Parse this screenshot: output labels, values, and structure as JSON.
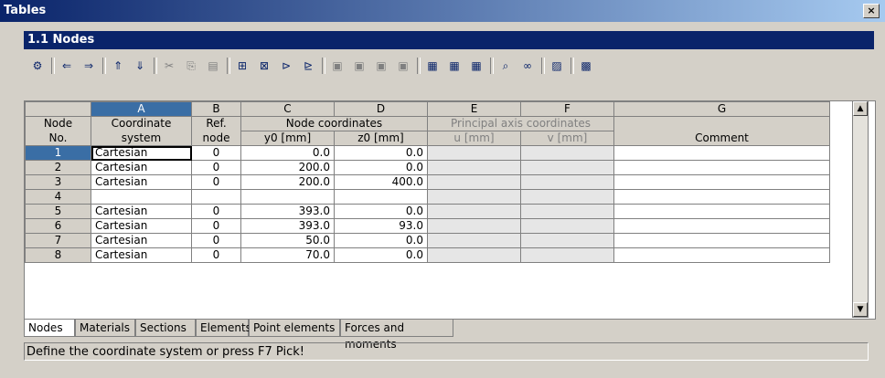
{
  "window": {
    "title": "Tables"
  },
  "panel": {
    "title": "1.1 Nodes"
  },
  "toolbar": {
    "buttons": [
      {
        "icon": "properties-icon",
        "glyph": "⚙"
      },
      {
        "icon": "arrow-left-icon",
        "glyph": "⇐"
      },
      {
        "icon": "arrow-right-icon",
        "glyph": "⇒"
      },
      {
        "icon": "move-up-icon",
        "glyph": "⇑"
      },
      {
        "icon": "move-down-icon",
        "glyph": "⇓"
      },
      {
        "icon": "cut-icon",
        "glyph": "✂"
      },
      {
        "icon": "copy-icon",
        "glyph": "⎘"
      },
      {
        "icon": "paste-icon",
        "glyph": "▤"
      },
      {
        "icon": "insert-row-icon",
        "glyph": "⊞"
      },
      {
        "icon": "delete-row-icon",
        "glyph": "⊠"
      },
      {
        "icon": "insert-column-icon",
        "glyph": "⊳"
      },
      {
        "icon": "append-column-icon",
        "glyph": "⊵"
      },
      {
        "icon": "view1-icon",
        "glyph": "▣"
      },
      {
        "icon": "view2-icon",
        "glyph": "▣"
      },
      {
        "icon": "view3-icon",
        "glyph": "▣"
      },
      {
        "icon": "view4-icon",
        "glyph": "▣"
      },
      {
        "icon": "screen1-icon",
        "glyph": "▦"
      },
      {
        "icon": "screen2-icon",
        "glyph": "▦"
      },
      {
        "icon": "screen3-icon",
        "glyph": "▦"
      },
      {
        "icon": "filter-icon",
        "glyph": "⌕"
      },
      {
        "icon": "glasses-icon",
        "glyph": "∞"
      },
      {
        "icon": "picture-icon",
        "glyph": "▨"
      },
      {
        "icon": "calculator-icon",
        "glyph": "▩"
      }
    ]
  },
  "table": {
    "col_letters": [
      "A",
      "B",
      "C",
      "D",
      "E",
      "F",
      "G"
    ],
    "headers": {
      "node_no_1": "Node",
      "node_no_2": "No.",
      "a_1": "Coordinate",
      "a_2": "system",
      "b_1": "Ref.",
      "b_2": "node",
      "cd_1": "Node coordinates",
      "c_2": "y0 [mm]",
      "d_2": "z0 [mm]",
      "ef_1": "Principal axis coordinates",
      "e_2": "u [mm]",
      "f_2": "v [mm]",
      "g_2": "Comment"
    },
    "rows": [
      {
        "no": "1",
        "system": "Cartesian",
        "ref": "0",
        "y": "0.0",
        "z": "0.0",
        "u": "",
        "v": "",
        "comment": ""
      },
      {
        "no": "2",
        "system": "Cartesian",
        "ref": "0",
        "y": "200.0",
        "z": "0.0",
        "u": "",
        "v": "",
        "comment": ""
      },
      {
        "no": "3",
        "system": "Cartesian",
        "ref": "0",
        "y": "200.0",
        "z": "400.0",
        "u": "",
        "v": "",
        "comment": ""
      },
      {
        "no": "4",
        "system": "",
        "ref": "",
        "y": "",
        "z": "",
        "u": "",
        "v": "",
        "comment": ""
      },
      {
        "no": "5",
        "system": "Cartesian",
        "ref": "0",
        "y": "393.0",
        "z": "0.0",
        "u": "",
        "v": "",
        "comment": ""
      },
      {
        "no": "6",
        "system": "Cartesian",
        "ref": "0",
        "y": "393.0",
        "z": "93.0",
        "u": "",
        "v": "",
        "comment": ""
      },
      {
        "no": "7",
        "system": "Cartesian",
        "ref": "0",
        "y": "50.0",
        "z": "0.0",
        "u": "",
        "v": "",
        "comment": ""
      },
      {
        "no": "8",
        "system": "Cartesian",
        "ref": "0",
        "y": "70.0",
        "z": "0.0",
        "u": "",
        "v": "",
        "comment": ""
      }
    ]
  },
  "tabs": [
    "Nodes",
    "Materials",
    "Sections",
    "Elements",
    "Point elements",
    "Forces and moments"
  ],
  "status": {
    "text": "Define the coordinate system or press F7 Pick!"
  },
  "colors": {
    "title_dark": "#0a246a",
    "selection": "#3a6ea5",
    "shaded": "#e6e6e6"
  }
}
